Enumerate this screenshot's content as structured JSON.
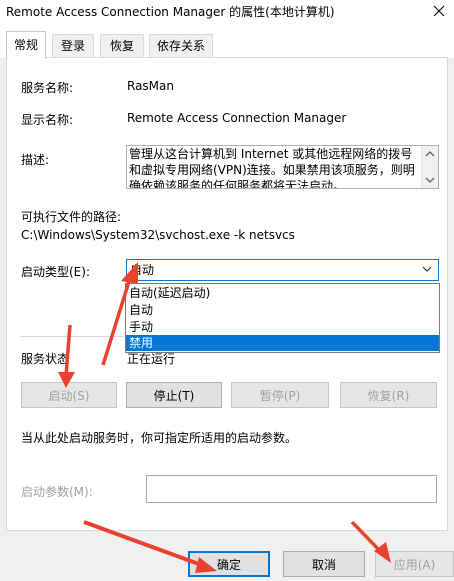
{
  "window": {
    "title": "Remote Access Connection Manager 的属性(本地计算机)"
  },
  "tabs": [
    {
      "label": "常规",
      "active": true
    },
    {
      "label": "登录"
    },
    {
      "label": "恢复"
    },
    {
      "label": "依存关系"
    }
  ],
  "general": {
    "service_name_label": "服务名称:",
    "service_name_value": "RasMan",
    "display_name_label": "显示名称:",
    "display_name_value": "Remote Access Connection Manager",
    "description_label": "描述:",
    "description_value": "管理从这台计算机到 Internet 或其他远程网络的拨号和虚拟专用网络(VPN)连接。如果禁用该项服务，则明确依赖该服务的任何服务都将无法启动。",
    "exe_path_label": "可执行文件的路径:",
    "exe_path_value": "C:\\Windows\\System32\\svchost.exe -k netsvcs",
    "startup_type_label": "启动类型(E):",
    "startup_type_value": "自动",
    "startup_options": [
      "自动(延迟启动)",
      "自动",
      "手动",
      "禁用"
    ],
    "startup_selected_index": 3,
    "service_status_label": "服务状态",
    "service_status_value": "正在运行",
    "buttons": {
      "start": "启动(S)",
      "stop": "停止(T)",
      "pause": "暂停(P)",
      "resume": "恢复(R)"
    },
    "hint": "当从此处启动服务时，你可指定所适用的启动参数。",
    "start_params_label": "启动参数(M):",
    "start_params_value": ""
  },
  "footer": {
    "ok": "确定",
    "cancel": "取消",
    "apply": "应用(A)"
  },
  "colors": {
    "accent": "#0078d7",
    "annotation_arrow": "#e8412f"
  },
  "icons": {
    "close": "close-icon",
    "chevron": "chevron-down-icon",
    "scrollbar_up": "scroll-up-icon",
    "scrollbar_down": "scroll-down-icon"
  }
}
